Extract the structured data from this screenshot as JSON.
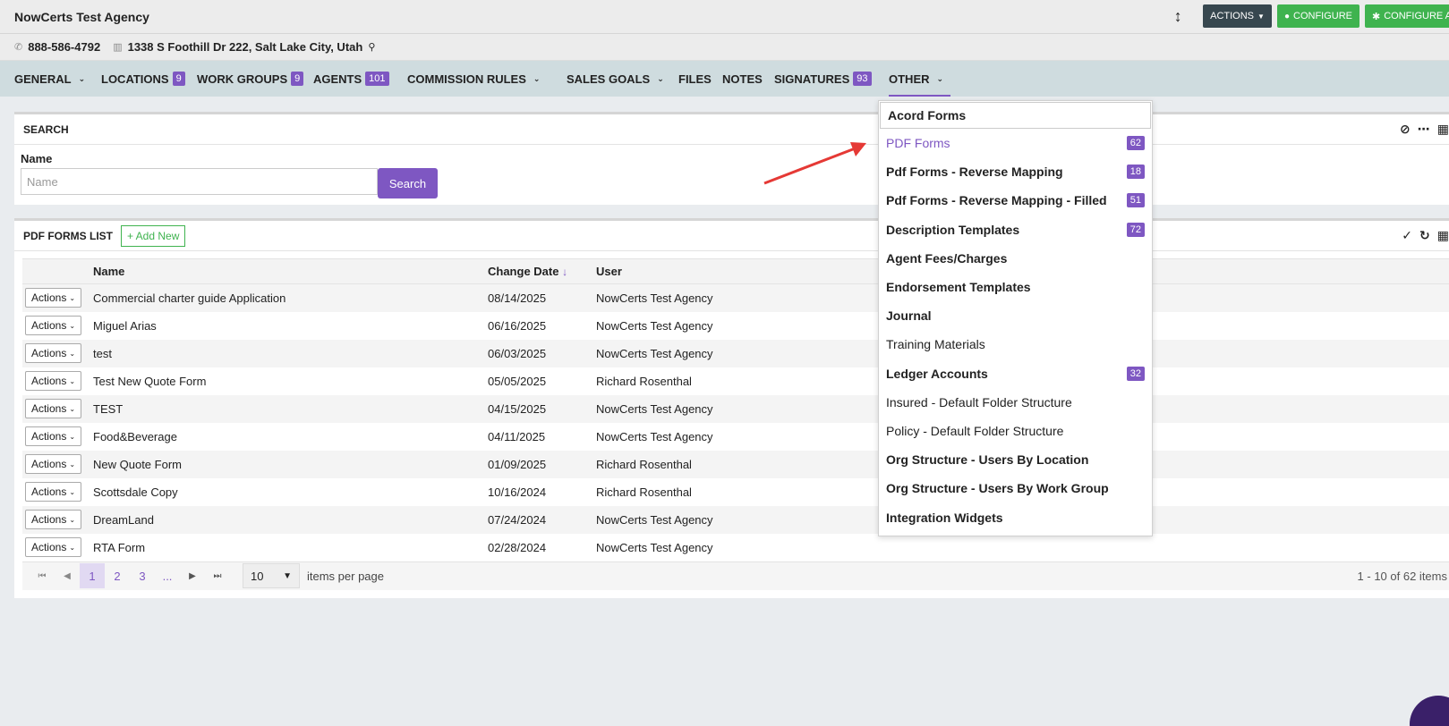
{
  "header": {
    "agency_name": "NowCerts Test Agency",
    "actions_label": "ACTIONS",
    "configure_label": "CONFIGURE",
    "configure_agency_label": "CONFIGURE A"
  },
  "contact": {
    "phone": "888-586-4792",
    "address": "1338 S Foothill Dr 222, Salt Lake City, Utah"
  },
  "nav": {
    "items": [
      {
        "label": "GENERAL",
        "chevron": true
      },
      {
        "label": "LOCATIONS",
        "badge": "9"
      },
      {
        "label": "WORK GROUPS",
        "badge": "9"
      },
      {
        "label": "AGENTS",
        "badge": "101"
      },
      {
        "label": "COMMISSION RULES",
        "chevron": true
      },
      {
        "label": "SALES GOALS",
        "chevron": true
      },
      {
        "label": "FILES"
      },
      {
        "label": "NOTES"
      },
      {
        "label": "SIGNATURES",
        "badge": "93"
      },
      {
        "label": "OTHER",
        "chevron": true
      }
    ]
  },
  "search": {
    "title": "SEARCH",
    "name_label": "Name",
    "name_placeholder": "Name",
    "button": "Search"
  },
  "list": {
    "title": "PDF FORMS LIST",
    "add_new": "+ Add New",
    "columns": [
      "Name",
      "Change Date",
      "User"
    ],
    "sort_indicator": "↓",
    "actions_label": "Actions",
    "rows": [
      {
        "name": "Commercial charter guide Application",
        "date": "08/14/2025",
        "user": "NowCerts Test Agency"
      },
      {
        "name": "Miguel Arias",
        "date": "06/16/2025",
        "user": "NowCerts Test Agency"
      },
      {
        "name": "test",
        "date": "06/03/2025",
        "user": "NowCerts Test Agency"
      },
      {
        "name": "Test New Quote Form",
        "date": "05/05/2025",
        "user": "Richard Rosenthal"
      },
      {
        "name": "TEST",
        "date": "04/15/2025",
        "user": "NowCerts Test Agency"
      },
      {
        "name": "Food&Beverage",
        "date": "04/11/2025",
        "user": "NowCerts Test Agency"
      },
      {
        "name": "New Quote Form",
        "date": "01/09/2025",
        "user": "Richard Rosenthal"
      },
      {
        "name": "Scottsdale Copy",
        "date": "10/16/2024",
        "user": "Richard Rosenthal"
      },
      {
        "name": "DreamLand",
        "date": "07/24/2024",
        "user": "NowCerts Test Agency"
      },
      {
        "name": "RTA Form",
        "date": "02/28/2024",
        "user": "NowCerts Test Agency"
      }
    ]
  },
  "pager": {
    "pages": [
      "1",
      "2",
      "3",
      "..."
    ],
    "current_page": "1",
    "per_page": "10",
    "per_page_label": "items per page",
    "info": "1 - 10 of 62 items"
  },
  "dropdown": {
    "items": [
      {
        "label": "Acord Forms",
        "bold": true
      },
      {
        "label": "PDF Forms",
        "badge": "62",
        "highlight": true
      },
      {
        "label": "Pdf Forms - Reverse Mapping",
        "badge": "18",
        "bold": true
      },
      {
        "label": "Pdf Forms - Reverse Mapping - Filled",
        "badge": "51",
        "bold": true
      },
      {
        "label": "Description Templates",
        "badge": "72",
        "bold": true
      },
      {
        "label": "Agent Fees/Charges",
        "bold": true
      },
      {
        "label": "Endorsement Templates",
        "bold": true
      },
      {
        "label": "Journal",
        "bold": true
      },
      {
        "label": "Training Materials"
      },
      {
        "label": "Ledger Accounts",
        "badge": "32",
        "bold": true
      },
      {
        "label": "Insured - Default Folder Structure"
      },
      {
        "label": "Policy - Default Folder Structure"
      },
      {
        "label": "Org Structure - Users By Location",
        "bold": true
      },
      {
        "label": "Org Structure - Users By Work Group",
        "bold": true
      },
      {
        "label": "Integration Widgets",
        "bold": true
      }
    ]
  },
  "colors": {
    "accent": "#7e57c2",
    "green": "#3fb34f",
    "dark_button": "#37474f",
    "nav_bg": "#cfdcdf",
    "annotation_arrow": "#e53935"
  }
}
